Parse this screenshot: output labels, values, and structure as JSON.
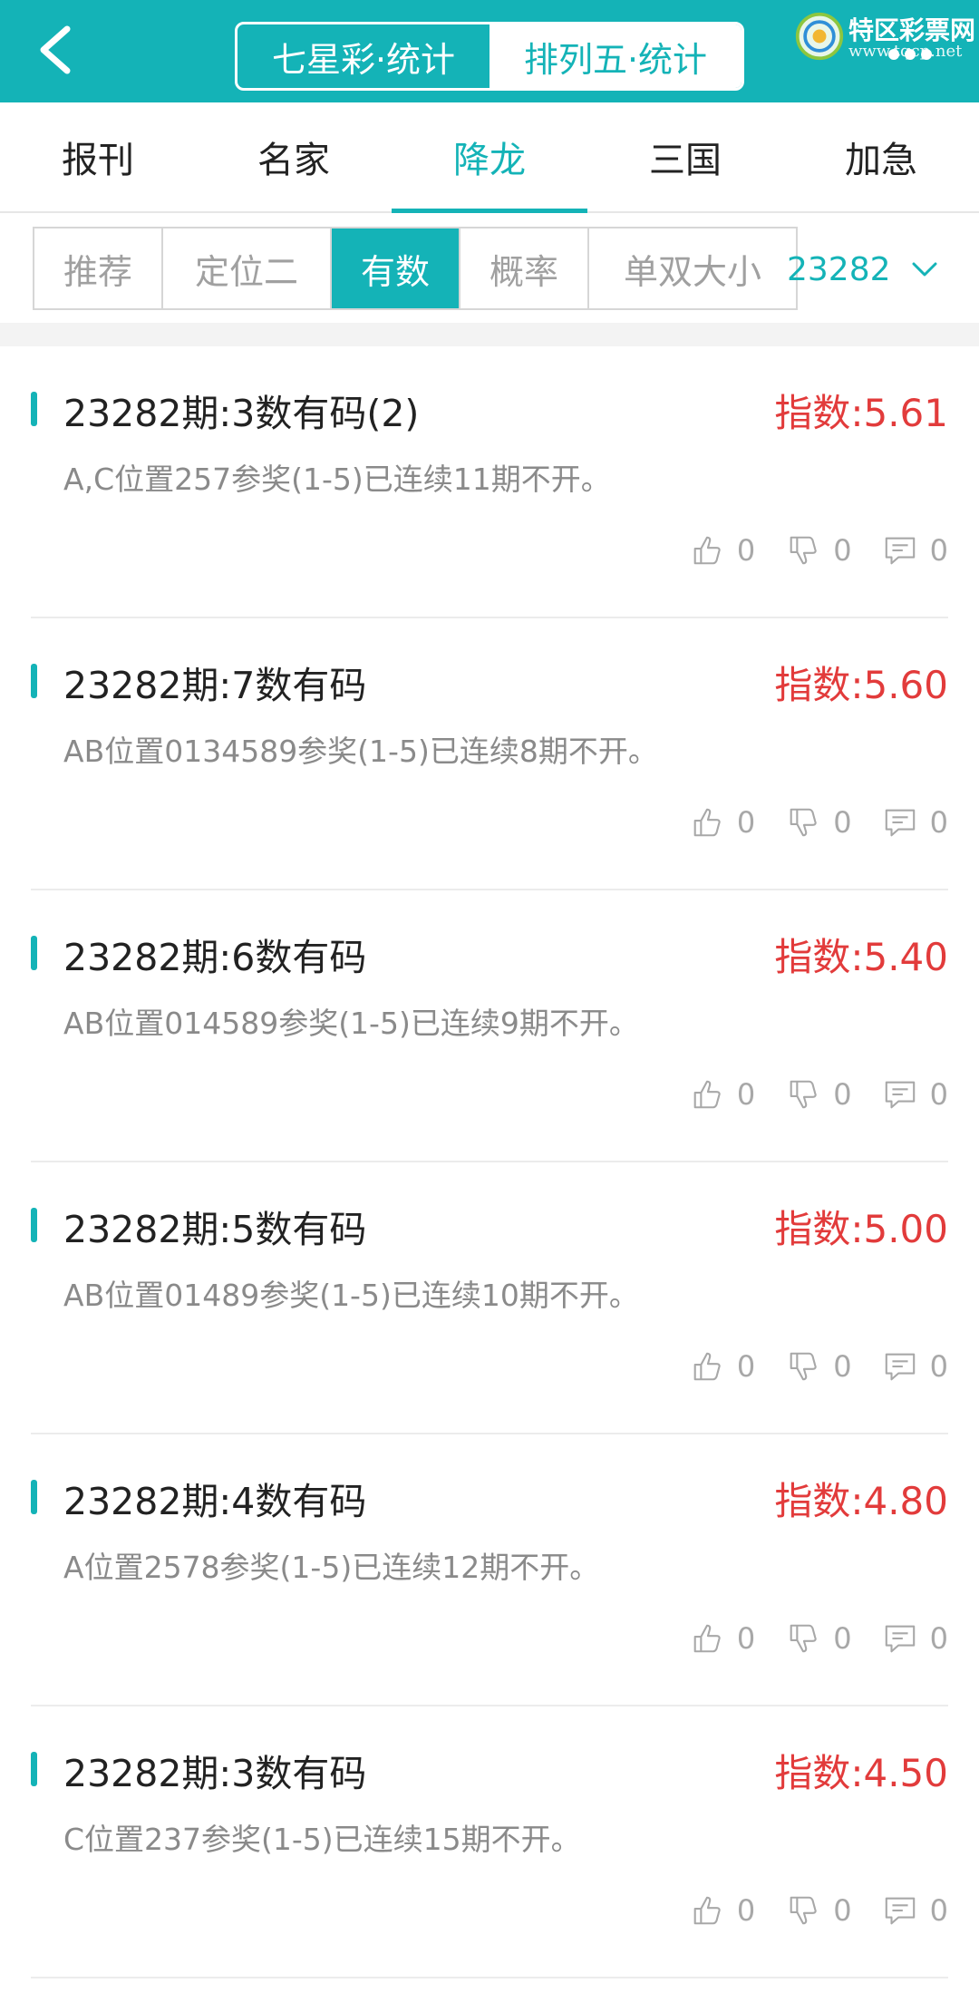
{
  "header": {
    "back_icon": "chevron-left-icon",
    "segments": [
      {
        "label": "七星彩·统计",
        "active": true
      },
      {
        "label": "排列五·统计",
        "active": false
      }
    ],
    "logo_text": "特区彩票网",
    "logo_sub": "www.tqcp.net"
  },
  "main_tabs": [
    {
      "label": "报刊",
      "active": false
    },
    {
      "label": "名家",
      "active": false
    },
    {
      "label": "降龙",
      "active": true
    },
    {
      "label": "三国",
      "active": false
    },
    {
      "label": "加急",
      "active": false
    }
  ],
  "sub_tabs": [
    {
      "label": "推荐",
      "active": false
    },
    {
      "label": "定位二",
      "active": false
    },
    {
      "label": "有数",
      "active": true
    },
    {
      "label": "概率",
      "active": false
    },
    {
      "label": "单双大小",
      "active": false
    }
  ],
  "issue_select": {
    "value": "23282",
    "icon": "chevron-down-icon"
  },
  "items": [
    {
      "title": "23282期:3数有码(2)",
      "score": "指数:5.61",
      "desc": "A,C位置257参奖(1-5)已连续11期不开。",
      "likes": "0",
      "dislikes": "0",
      "comments": "0"
    },
    {
      "title": "23282期:7数有码",
      "score": "指数:5.60",
      "desc": "AB位置0134589参奖(1-5)已连续8期不开。",
      "likes": "0",
      "dislikes": "0",
      "comments": "0"
    },
    {
      "title": "23282期:6数有码",
      "score": "指数:5.40",
      "desc": "AB位置014589参奖(1-5)已连续9期不开。",
      "likes": "0",
      "dislikes": "0",
      "comments": "0"
    },
    {
      "title": "23282期:5数有码",
      "score": "指数:5.00",
      "desc": "AB位置01489参奖(1-5)已连续10期不开。",
      "likes": "0",
      "dislikes": "0",
      "comments": "0"
    },
    {
      "title": "23282期:4数有码",
      "score": "指数:4.80",
      "desc": "A位置2578参奖(1-5)已连续12期不开。",
      "likes": "0",
      "dislikes": "0",
      "comments": "0"
    },
    {
      "title": "23282期:3数有码",
      "score": "指数:4.50",
      "desc": "C位置237参奖(1-5)已连续15期不开。",
      "likes": "0",
      "dislikes": "0",
      "comments": "0"
    }
  ],
  "colors": {
    "accent": "#14b3b7",
    "score_red": "#e23b3b",
    "muted": "#8a8a8a"
  }
}
